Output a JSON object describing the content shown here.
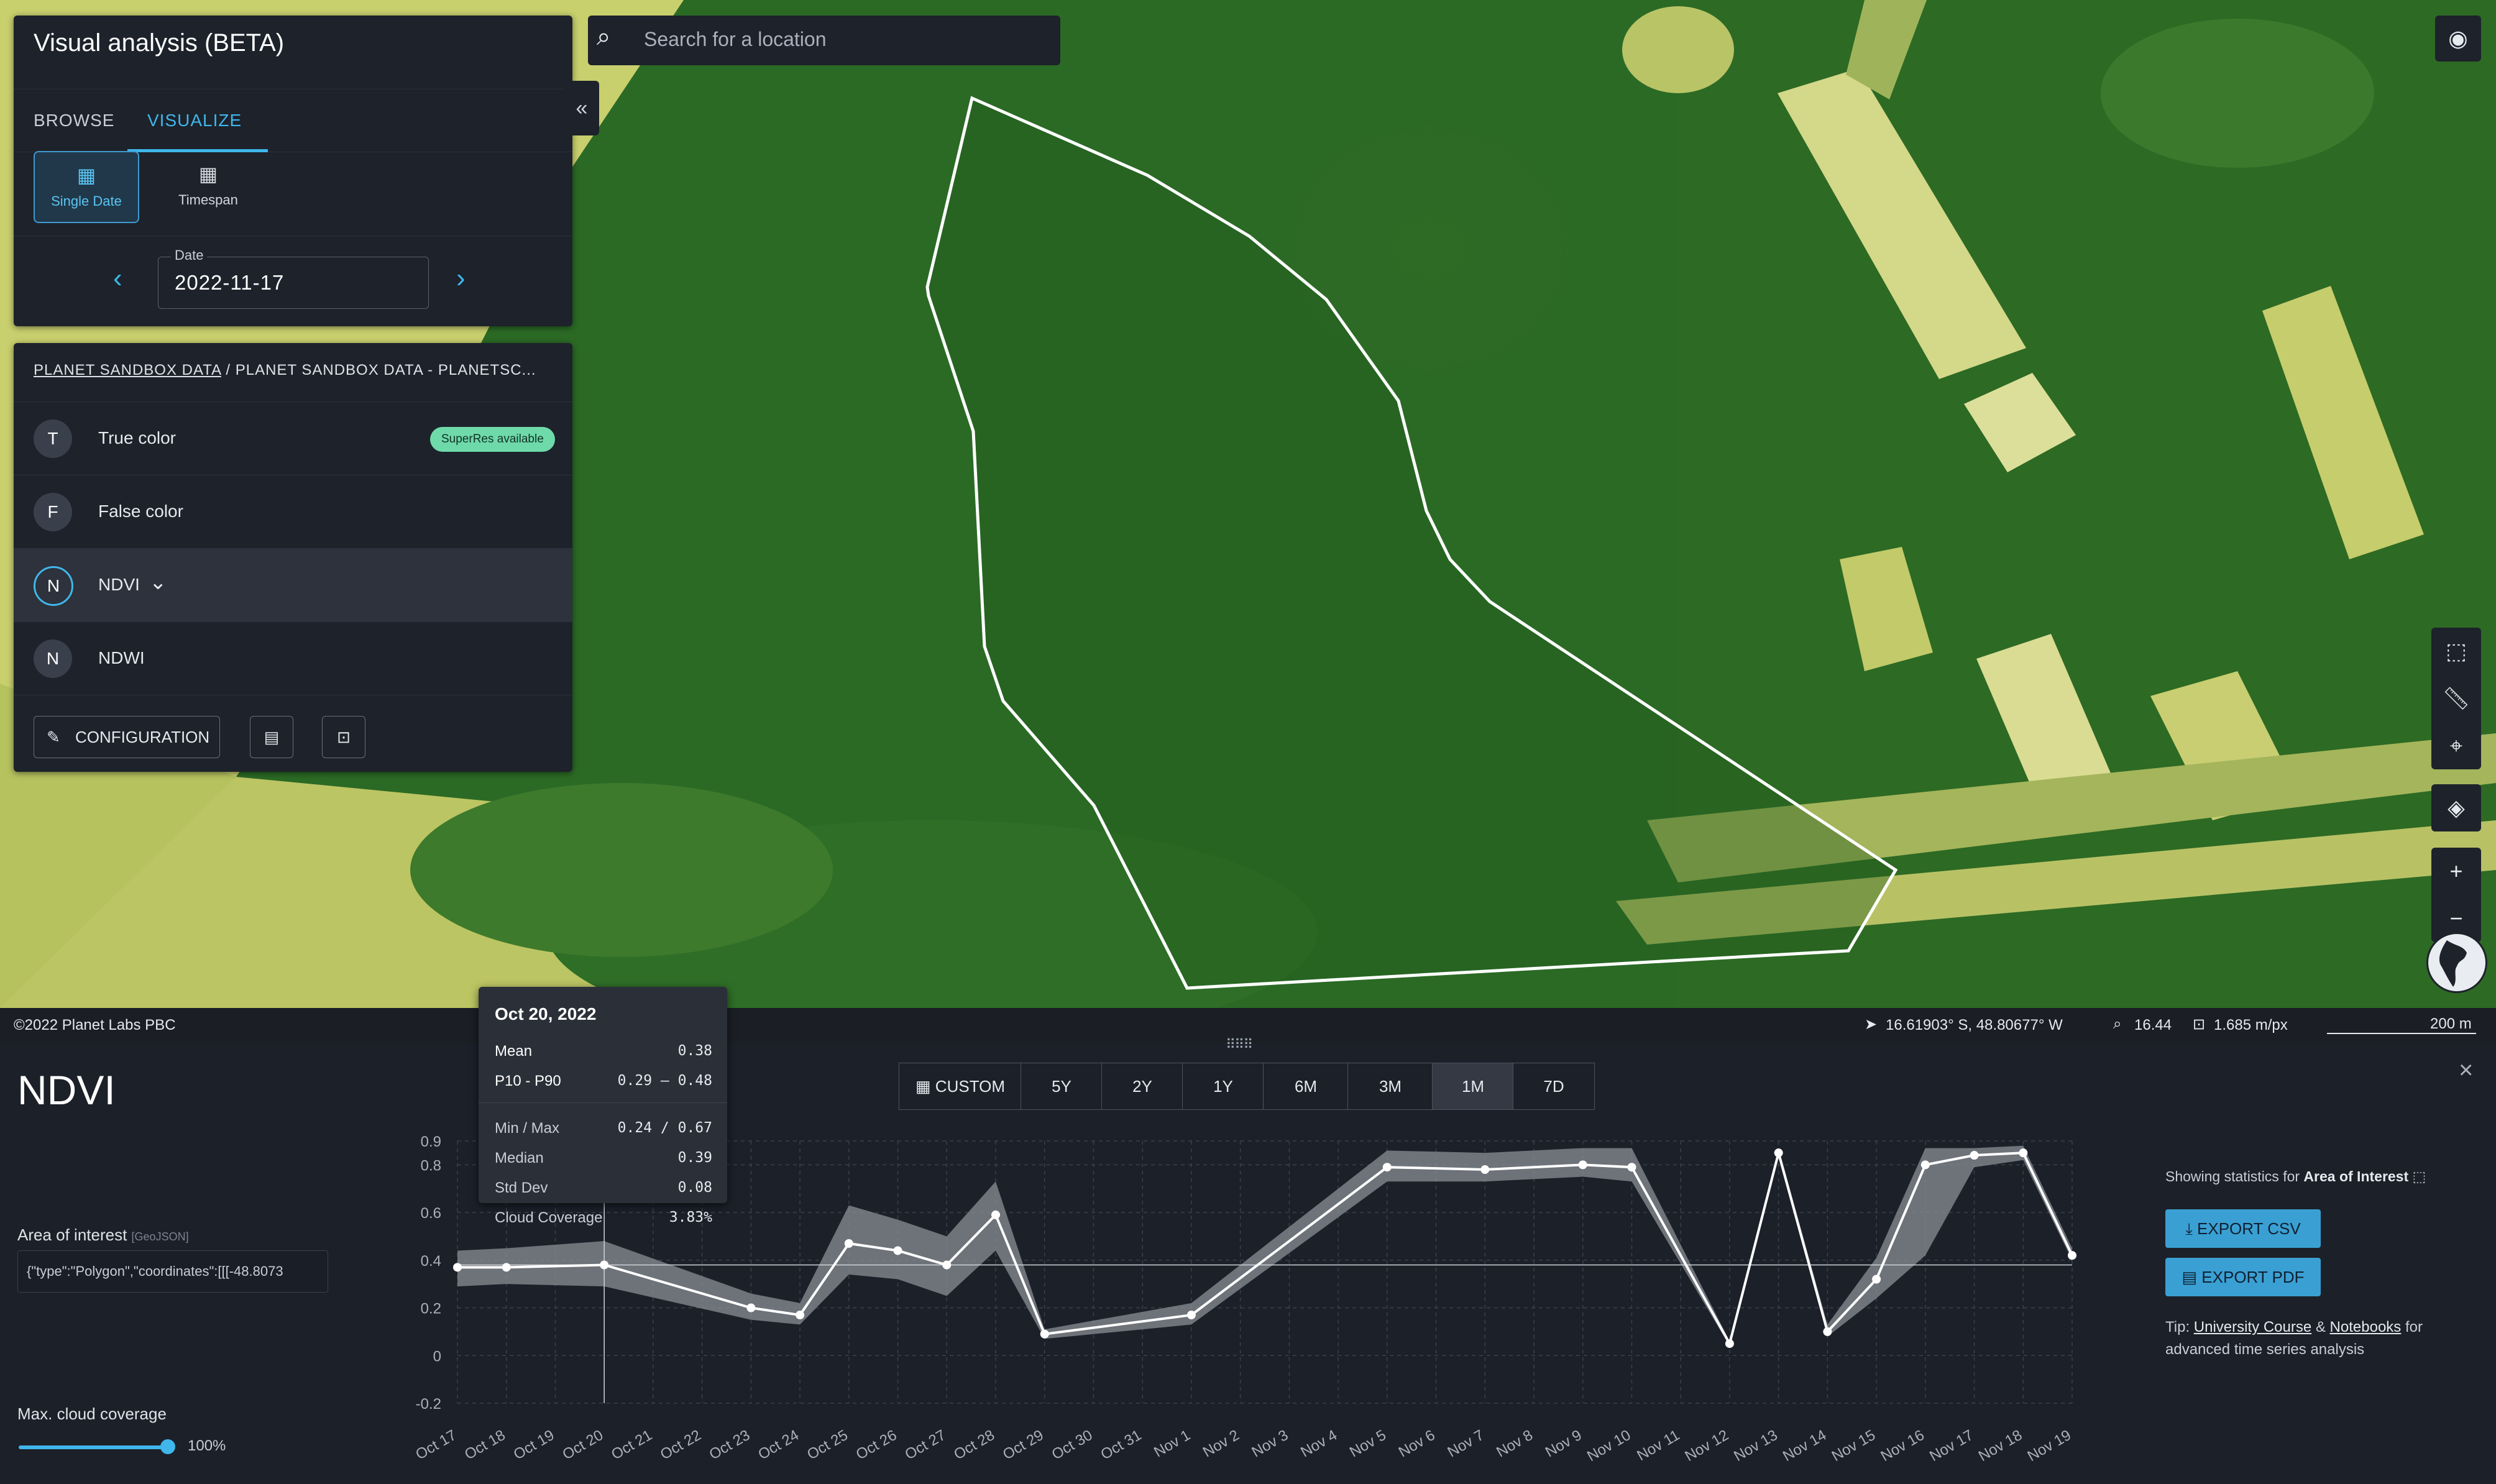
{
  "app": {
    "title": "Visual analysis (BETA)",
    "collapse_icon": "«"
  },
  "tabs": [
    {
      "label": "BROWSE"
    },
    {
      "label": "VISUALIZE"
    }
  ],
  "mode": {
    "single_date": "Single Date",
    "timespan": "Timespan"
  },
  "date": {
    "label": "Date",
    "value": "2022-11-17"
  },
  "breadcrumb": {
    "root": "PLANET SANDBOX DATA",
    "sep": "/",
    "current": "PLANET SANDBOX DATA - PLANETSC..."
  },
  "layers": [
    {
      "letter": "T",
      "name": "True color",
      "badge": "SuperRes available"
    },
    {
      "letter": "F",
      "name": "False color"
    },
    {
      "letter": "N",
      "name": "NDVI",
      "selected": true
    },
    {
      "letter": "N",
      "name": "NDWI"
    }
  ],
  "config": {
    "label": "CONFIGURATION"
  },
  "search": {
    "placeholder": "Search for a location"
  },
  "status": {
    "copyright": "©2022 Planet Labs PBC",
    "coords": "16.61903° S, 48.80677° W",
    "zoom": "16.44",
    "resolution": "1.685 m/px",
    "scale": "200 m"
  },
  "panel": {
    "title": "NDVI",
    "aoi_label": "Area of interest",
    "aoi_sub": "[GeoJSON]",
    "aoi_value": "{\"type\":\"Polygon\",\"coordinates\":[[[-48.8073",
    "cloud_label": "Max. cloud coverage",
    "cloud_value": "100%",
    "showing_prefix": "Showing statistics for",
    "showing_target": "Area of Interest",
    "export_csv": "EXPORT CSV",
    "export_pdf": "EXPORT PDF",
    "tip_prefix": "Tip:",
    "tip_link1": "University Course",
    "tip_and": "&",
    "tip_link2": "Notebooks",
    "tip_suffix": "for advanced time series analysis"
  },
  "ranges": [
    {
      "label": "CUSTOM"
    },
    {
      "label": "5Y"
    },
    {
      "label": "2Y"
    },
    {
      "label": "1Y"
    },
    {
      "label": "6M"
    },
    {
      "label": "3M"
    },
    {
      "label": "1M",
      "active": true
    },
    {
      "label": "7D"
    }
  ],
  "tooltip": {
    "date": "Oct 20, 2022",
    "mean_label": "Mean",
    "mean": "0.38",
    "p_label": "P10 - P90",
    "p_value": "0.29 – 0.48",
    "minmax_label": "Min / Max",
    "minmax": "0.24 / 0.67",
    "median_label": "Median",
    "median": "0.39",
    "std_label": "Std Dev",
    "std": "0.08",
    "cloud_label": "Cloud Coverage",
    "cloud": "3.83%"
  },
  "colors": {
    "accent": "#3fb7ea",
    "line": "#ffffff",
    "band": "#8a8f96",
    "map_dark": "#1f5a1f",
    "map_light": "#c9cf6c"
  },
  "chart_data": {
    "type": "line",
    "title": "NDVI",
    "x": [
      "Oct 17",
      "Oct 18",
      "Oct 19",
      "Oct 20",
      "Oct 21",
      "Oct 22",
      "Oct 23",
      "Oct 24",
      "Oct 25",
      "Oct 26",
      "Oct 27",
      "Oct 28",
      "Oct 29",
      "Oct 30",
      "Oct 31",
      "Nov 1",
      "Nov 2",
      "Nov 3",
      "Nov 4",
      "Nov 5",
      "Nov 6",
      "Nov 7",
      "Nov 8",
      "Nov 9",
      "Nov 10",
      "Nov 11",
      "Nov 12",
      "Nov 13",
      "Nov 14",
      "Nov 15",
      "Nov 16",
      "Nov 17",
      "Nov 18",
      "Nov 19"
    ],
    "yticks": [
      "0.9",
      "0.8",
      "0.6",
      "0.4",
      "0.2",
      "0",
      "-0.2"
    ],
    "ylim": [
      -0.2,
      0.9
    ],
    "grid": true,
    "series": [
      {
        "points": [
          {
            "x": "Oct 17",
            "y": 0.37,
            "lo": 0.29,
            "hi": 0.44
          },
          {
            "x": "Oct 18",
            "y": 0.37,
            "lo": 0.3,
            "hi": 0.45
          },
          {
            "x": "Oct 20",
            "y": 0.38,
            "lo": 0.29,
            "hi": 0.48
          },
          {
            "x": "Oct 23",
            "y": 0.2,
            "lo": 0.15,
            "hi": 0.26
          },
          {
            "x": "Oct 24",
            "y": 0.17,
            "lo": 0.13,
            "hi": 0.22
          },
          {
            "x": "Oct 25",
            "y": 0.47,
            "lo": 0.34,
            "hi": 0.63
          },
          {
            "x": "Oct 26",
            "y": 0.44,
            "lo": 0.32,
            "hi": 0.57
          },
          {
            "x": "Oct 27",
            "y": 0.38,
            "lo": 0.25,
            "hi": 0.5
          },
          {
            "x": "Oct 28",
            "y": 0.59,
            "lo": 0.44,
            "hi": 0.73
          },
          {
            "x": "Oct 29",
            "y": 0.09,
            "lo": 0.07,
            "hi": 0.11
          },
          {
            "x": "Nov 1",
            "y": 0.17,
            "lo": 0.13,
            "hi": 0.22
          },
          {
            "x": "Nov 5",
            "y": 0.79,
            "lo": 0.73,
            "hi": 0.86
          },
          {
            "x": "Nov 7",
            "y": 0.78,
            "lo": 0.73,
            "hi": 0.85
          },
          {
            "x": "Nov 9",
            "y": 0.8,
            "lo": 0.75,
            "hi": 0.87
          },
          {
            "x": "Nov 10",
            "y": 0.79,
            "lo": 0.73,
            "hi": 0.87
          },
          {
            "x": "Nov 12",
            "y": 0.05,
            "lo": 0.04,
            "hi": 0.06
          },
          {
            "x": "Nov 13",
            "y": 0.85,
            "lo": 0.83,
            "hi": 0.87
          },
          {
            "x": "Nov 14",
            "y": 0.1,
            "lo": 0.08,
            "hi": 0.13
          },
          {
            "x": "Nov 15",
            "y": 0.32,
            "lo": 0.24,
            "hi": 0.41
          },
          {
            "x": "Nov 16",
            "y": 0.8,
            "lo": 0.42,
            "hi": 0.87
          },
          {
            "x": "Nov 17",
            "y": 0.84,
            "lo": 0.79,
            "hi": 0.87
          },
          {
            "x": "Nov 18",
            "y": 0.85,
            "lo": 0.82,
            "hi": 0.88
          },
          {
            "x": "Nov 19",
            "y": 0.42,
            "lo": 0.4,
            "hi": 0.45
          }
        ]
      }
    ]
  }
}
